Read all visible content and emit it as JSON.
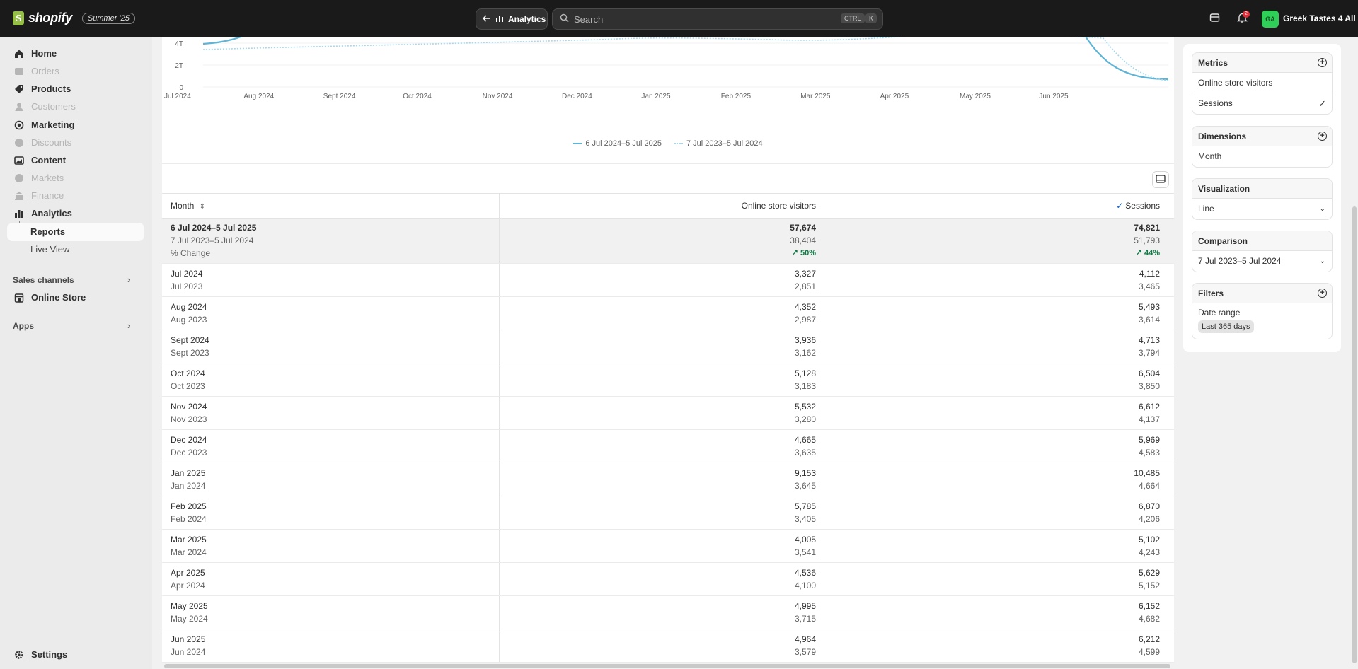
{
  "topbar": {
    "logo_text": "shopify",
    "edition_badge": "Summer '25",
    "back_label": "Analytics",
    "search_placeholder": "Search",
    "shortcut_ctrl": "CTRL",
    "shortcut_key": "K",
    "notification_count": "2",
    "store_initials": "GA",
    "store_name": "Greek Tastes 4 All"
  },
  "sidebar": {
    "items": [
      {
        "label": "Home",
        "icon": "home-icon",
        "enabled": true
      },
      {
        "label": "Orders",
        "icon": "inbox-icon",
        "enabled": false
      },
      {
        "label": "Products",
        "icon": "tag-icon",
        "enabled": true
      },
      {
        "label": "Customers",
        "icon": "person-icon",
        "enabled": false
      },
      {
        "label": "Marketing",
        "icon": "target-icon",
        "enabled": true
      },
      {
        "label": "Discounts",
        "icon": "discount-icon",
        "enabled": false
      },
      {
        "label": "Content",
        "icon": "image-icon",
        "enabled": true
      },
      {
        "label": "Markets",
        "icon": "globe-icon",
        "enabled": false
      },
      {
        "label": "Finance",
        "icon": "bank-icon",
        "enabled": false
      },
      {
        "label": "Analytics",
        "icon": "bar-chart-icon",
        "enabled": true
      }
    ],
    "sub_items": [
      "Reports",
      "Live View"
    ],
    "sales_channels_label": "Sales channels",
    "online_store_label": "Online Store",
    "apps_label": "Apps",
    "settings_label": "Settings"
  },
  "chart_data": {
    "type": "line",
    "y_tick_labels": [
      "0",
      "2T",
      "4T"
    ],
    "x_tick_labels": [
      "Jul 2024",
      "Aug 2024",
      "Sept 2024",
      "Oct 2024",
      "Nov 2024",
      "Dec 2024",
      "Jan 2025",
      "Feb 2025",
      "Mar 2025",
      "Apr 2025",
      "May 2025",
      "Jun 2025"
    ],
    "legend": [
      "6 Jul 2024–5 Jul 2025",
      "7 Jul 2023–5 Jul 2024"
    ],
    "legend_position": "bottom-center",
    "grid": true,
    "colors": {
      "current": "#5fb4d6",
      "previous": "#a6d8ec"
    }
  },
  "table": {
    "headers": {
      "month": "Month",
      "visitors": "Online store visitors",
      "sessions": "Sessions"
    },
    "summary": {
      "current_label": "6 Jul 2024–5 Jul 2025",
      "previous_label": "7 Jul 2023–5 Jul 2024",
      "change_label": "% Change",
      "visitors_current": "57,674",
      "visitors_previous": "38,404",
      "visitors_change": "50%",
      "sessions_current": "74,821",
      "sessions_previous": "51,793",
      "sessions_change": "44%"
    },
    "rows": [
      {
        "month": "Jul 2024",
        "month_prev": "Jul 2023",
        "visitors": "3,327",
        "visitors_prev": "2,851",
        "sessions": "4,112",
        "sessions_prev": "3,465"
      },
      {
        "month": "Aug 2024",
        "month_prev": "Aug 2023",
        "visitors": "4,352",
        "visitors_prev": "2,987",
        "sessions": "5,493",
        "sessions_prev": "3,614"
      },
      {
        "month": "Sept 2024",
        "month_prev": "Sept 2023",
        "visitors": "3,936",
        "visitors_prev": "3,162",
        "sessions": "4,713",
        "sessions_prev": "3,794"
      },
      {
        "month": "Oct 2024",
        "month_prev": "Oct 2023",
        "visitors": "5,128",
        "visitors_prev": "3,183",
        "sessions": "6,504",
        "sessions_prev": "3,850"
      },
      {
        "month": "Nov 2024",
        "month_prev": "Nov 2023",
        "visitors": "5,532",
        "visitors_prev": "3,280",
        "sessions": "6,612",
        "sessions_prev": "4,137"
      },
      {
        "month": "Dec 2024",
        "month_prev": "Dec 2023",
        "visitors": "4,665",
        "visitors_prev": "3,635",
        "sessions": "5,969",
        "sessions_prev": "4,583"
      },
      {
        "month": "Jan 2025",
        "month_prev": "Jan 2024",
        "visitors": "9,153",
        "visitors_prev": "3,645",
        "sessions": "10,485",
        "sessions_prev": "4,664"
      },
      {
        "month": "Feb 2025",
        "month_prev": "Feb 2024",
        "visitors": "5,785",
        "visitors_prev": "3,405",
        "sessions": "6,870",
        "sessions_prev": "4,206"
      },
      {
        "month": "Mar 2025",
        "month_prev": "Mar 2024",
        "visitors": "4,005",
        "visitors_prev": "3,541",
        "sessions": "5,102",
        "sessions_prev": "4,243"
      },
      {
        "month": "Apr 2025",
        "month_prev": "Apr 2024",
        "visitors": "4,536",
        "visitors_prev": "4,100",
        "sessions": "5,629",
        "sessions_prev": "5,152"
      },
      {
        "month": "May 2025",
        "month_prev": "May 2024",
        "visitors": "4,995",
        "visitors_prev": "3,715",
        "sessions": "6,152",
        "sessions_prev": "4,682"
      },
      {
        "month": "Jun 2025",
        "month_prev": "Jun 2024",
        "visitors": "4,964",
        "visitors_prev": "3,579",
        "sessions": "6,212",
        "sessions_prev": "4,599"
      }
    ]
  },
  "panel": {
    "metrics_title": "Metrics",
    "metrics": [
      "Online store visitors",
      "Sessions"
    ],
    "dimensions_title": "Dimensions",
    "dimension_value": "Month",
    "visualization_title": "Visualization",
    "visualization_value": "Line",
    "comparison_title": "Comparison",
    "comparison_value": "7 Jul 2023–5 Jul 2024",
    "filters_title": "Filters",
    "filter_name": "Date range",
    "filter_value": "Last 365 days"
  }
}
